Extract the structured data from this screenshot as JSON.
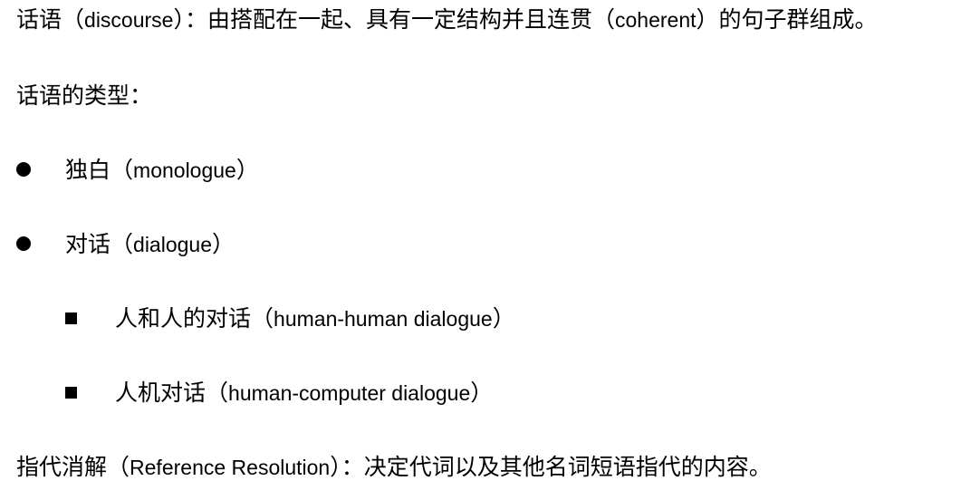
{
  "lines": {
    "discourse_def": {
      "term": "话语",
      "open": "（",
      "en": "discourse",
      "close": "）",
      "text": "：由搭配在一起、具有一定结构并且连贯",
      "open2": "（",
      "en2": "coherent",
      "close2": "）",
      "text2": "的句子群组成。"
    },
    "types_heading": "话语的类型：",
    "monologue": {
      "term": "独白",
      "open": "（",
      "en": "monologue",
      "close": "）"
    },
    "dialogue": {
      "term": "对话",
      "open": "（",
      "en": "dialogue",
      "close": "）"
    },
    "hh_dialogue": {
      "term": "人和人的对话",
      "open": "（",
      "en": "human-human dialogue",
      "close": "）"
    },
    "hc_dialogue": {
      "term": "人机对话",
      "open": "（",
      "en": "human-computer dialogue",
      "close": "）"
    },
    "reference_def": {
      "term": "指代消解",
      "open": "（",
      "en": "Reference Resolution",
      "close": "）",
      "text": "：决定代词以及其他名词短语指代的内容。"
    }
  },
  "bullets": {
    "level1_icon": "filled-circle-bullet",
    "level2_icon": "filled-square-bullet"
  }
}
